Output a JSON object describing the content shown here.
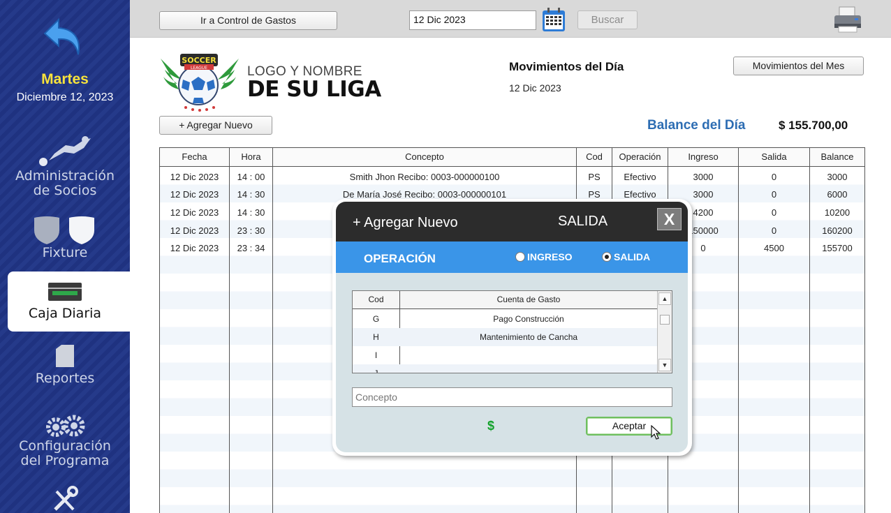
{
  "sidebar": {
    "day_name": "Martes",
    "day_date": "Diciembre 12, 2023",
    "items": [
      {
        "label_line1": "Administración",
        "label_line2": "de Socios",
        "icon": "soccer-player-icon"
      },
      {
        "label_line1": "Fixture",
        "label_line2": "",
        "icon": "shield-icon"
      },
      {
        "label_line1": "Caja Diaria",
        "label_line2": "",
        "icon": "cash-register-icon",
        "active": true
      },
      {
        "label_line1": "Reportes",
        "label_line2": "",
        "icon": "document-icon"
      },
      {
        "label_line1": "Configuración",
        "label_line2": "del Programa",
        "icon": "gears-icon"
      },
      {
        "label_line1": "",
        "label_line2": "",
        "icon": "tools-icon"
      }
    ]
  },
  "topbar": {
    "expenses_button": "Ir a Control de Gastos",
    "date_value": "12 Dic 2023",
    "search_button": "Buscar"
  },
  "header": {
    "logo_line1": "LOGO Y NOMBRE",
    "logo_line2": "DE SU LIGA",
    "logo_badge": "SOCCER",
    "logo_ribbon": "LEAGUE",
    "movements_title": "Movimientos del Día",
    "movements_date": "12 Dic 2023",
    "month_button": "Movimientos del Mes",
    "add_button": "+ Agregar Nuevo",
    "balance_label": "Balance del Día",
    "balance_value": "$ 155.700,00"
  },
  "table": {
    "columns": [
      "Fecha",
      "Hora",
      "Concepto",
      "Cod",
      "Operación",
      "Ingreso",
      "Salida",
      "Balance"
    ],
    "rows": [
      [
        "12 Dic 2023",
        "14 : 00",
        "Smith Jhon Recibo: 0003-000000100",
        "PS",
        "Efectivo",
        "3000",
        "0",
        "3000"
      ],
      [
        "12 Dic 2023",
        "14 : 30",
        "De María José Recibo: 0003-000000101",
        "PS",
        "Efectivo",
        "3000",
        "0",
        "6000"
      ],
      [
        "12 Dic 2023",
        "14 : 30",
        "",
        "",
        "",
        "4200",
        "0",
        "10200"
      ],
      [
        "12 Dic 2023",
        "23 : 30",
        "",
        "",
        "",
        "150000",
        "0",
        "160200"
      ],
      [
        "12 Dic 2023",
        "23 : 34",
        "",
        "",
        "",
        "0",
        "4500",
        "155700"
      ]
    ]
  },
  "dialog": {
    "title": "+ Agregar Nuevo",
    "kind": "SALIDA",
    "close": "X",
    "operation_label": "OPERACIÓN",
    "radio_ingreso": "INGRESO",
    "radio_salida": "SALIDA",
    "selected_operation": "SALIDA",
    "accounts_columns": [
      "Cod",
      "Cuenta de Gasto"
    ],
    "accounts": [
      [
        "G",
        "Pago Construcción"
      ],
      [
        "H",
        "Mantenimiento de Cancha"
      ],
      [
        "I",
        ""
      ],
      [
        "J",
        ""
      ]
    ],
    "concept_placeholder": "Concepto",
    "currency_symbol": "$",
    "accept_button": "Aceptar"
  },
  "colors": {
    "sidebar": "#233888",
    "accent_yellow": "#f7e23c",
    "balance_blue": "#2d6db3",
    "dialog_header": "#2c2c2c",
    "operation_bar": "#3a95e8",
    "dollar_green": "#12a12a"
  }
}
